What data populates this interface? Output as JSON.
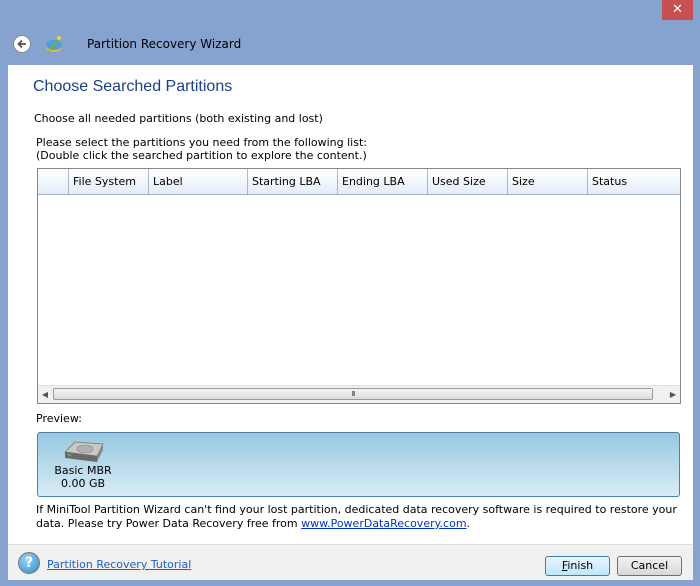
{
  "window": {
    "title": "Partition Recovery Wizard",
    "close_glyph": "✕"
  },
  "page": {
    "title": "Choose Searched Partitions",
    "subtitle": "Choose all needed partitions (both existing and lost)",
    "instruction_line1": "Please select the partitions you need from the following list:",
    "instruction_line2": "(Double click the searched partition to explore the content.)"
  },
  "grid": {
    "columns": [
      "",
      "File System",
      "Label",
      "Starting LBA",
      "Ending LBA",
      "Used Size",
      "Size",
      "Status"
    ],
    "rows": [],
    "scroll_left": "◀",
    "scroll_right": "▶",
    "scroll_grip": "III"
  },
  "preview": {
    "label": "Preview:",
    "disk": {
      "icon": "hard-disk-icon",
      "name": "Basic MBR",
      "size": "0.00 GB"
    }
  },
  "notice": {
    "text": "If MiniTool Partition Wizard can't find your lost partition, dedicated data recovery software is required to restore your data. Please try Power Data Recovery free from ",
    "link": "www.PowerDataRecovery.com",
    "suffix": "."
  },
  "footer": {
    "help_glyph": "?",
    "tutorial_link": "Partition Recovery Tutorial",
    "finish_label_mnemonic": "F",
    "finish_label_rest": "inish",
    "cancel_label": "Cancel"
  }
}
